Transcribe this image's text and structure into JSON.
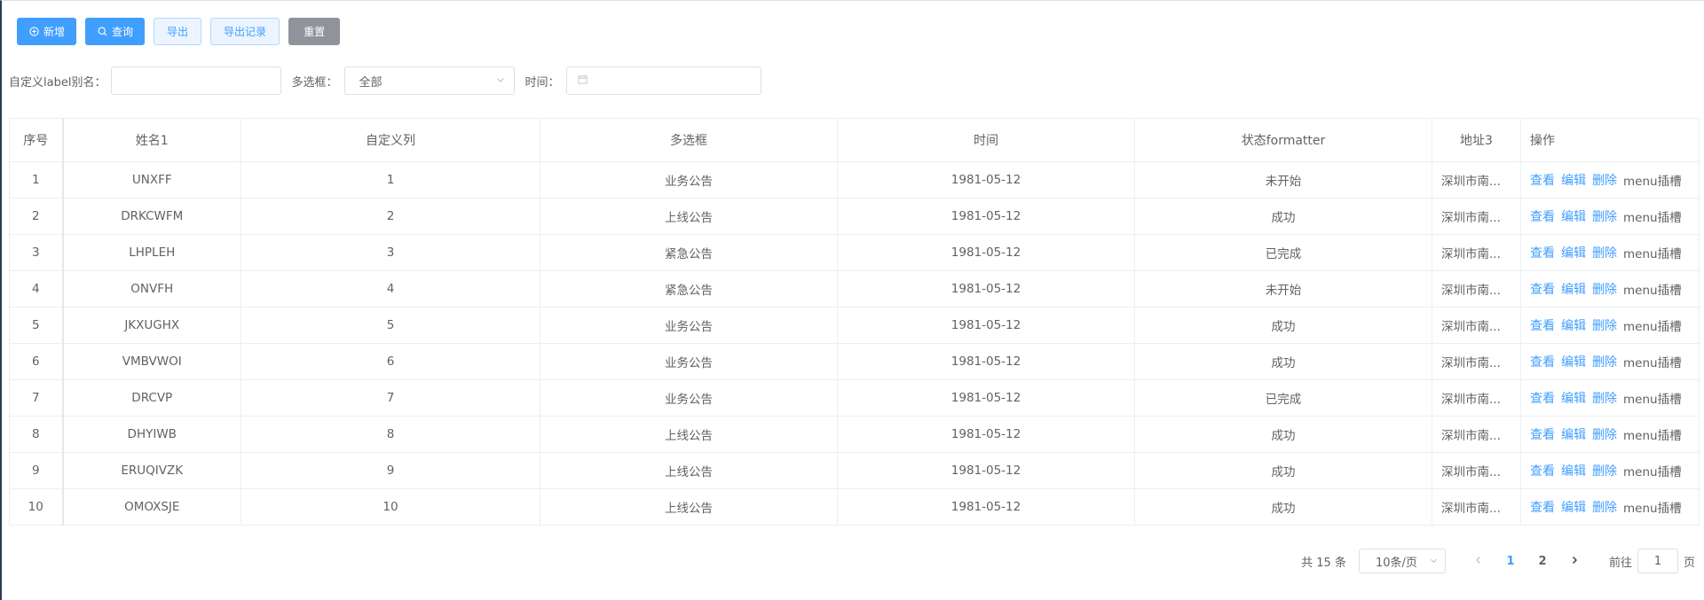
{
  "toolbar": {
    "add": "新增",
    "query": "查询",
    "export": "导出",
    "export_log": "导出记录",
    "reset": "重置"
  },
  "search": {
    "label_alias": "自定义label别名：",
    "label_alias_value": "",
    "multi_select": "多选框：",
    "multi_select_value": "全部",
    "time": "时间：",
    "time_value": ""
  },
  "table": {
    "headers": [
      "序号",
      "姓名1",
      "自定义列",
      "多选框",
      "时间",
      "状态formatter",
      "地址3",
      "操作"
    ],
    "rows": [
      [
        "1",
        "UNXFF",
        "1",
        "业务公告",
        "1981-05-12",
        "未开始",
        "深圳市南..."
      ],
      [
        "2",
        "DRKCWFM",
        "2",
        "上线公告",
        "1981-05-12",
        "成功",
        "深圳市南..."
      ],
      [
        "3",
        "LHPLEH",
        "3",
        "紧急公告",
        "1981-05-12",
        "已完成",
        "深圳市南..."
      ],
      [
        "4",
        "ONVFH",
        "4",
        "紧急公告",
        "1981-05-12",
        "未开始",
        "深圳市南..."
      ],
      [
        "5",
        "JKXUGHX",
        "5",
        "业务公告",
        "1981-05-12",
        "成功",
        "深圳市南..."
      ],
      [
        "6",
        "VMBVWOI",
        "6",
        "业务公告",
        "1981-05-12",
        "成功",
        "深圳市南..."
      ],
      [
        "7",
        "DRCVP",
        "7",
        "业务公告",
        "1981-05-12",
        "已完成",
        "深圳市南..."
      ],
      [
        "8",
        "DHYIWB",
        "8",
        "上线公告",
        "1981-05-12",
        "成功",
        "深圳市南..."
      ],
      [
        "9",
        "ERUQIVZK",
        "9",
        "上线公告",
        "1981-05-12",
        "成功",
        "深圳市南..."
      ],
      [
        "10",
        "OMOXSJE",
        "10",
        "上线公告",
        "1981-05-12",
        "成功",
        "深圳市南..."
      ]
    ],
    "actions": {
      "view": "查看",
      "edit": "编辑",
      "delete": "删除",
      "slot": "menu插槽"
    }
  },
  "pagination": {
    "total": "共 15 条",
    "page_size": "10条/页",
    "pages": [
      "1",
      "2"
    ],
    "current": "1",
    "goto_prefix": "前往",
    "goto_value": "1",
    "goto_suffix": "页"
  },
  "colors": {
    "primary": "#409eff",
    "info": "#909399",
    "border": "#ebeef5"
  }
}
